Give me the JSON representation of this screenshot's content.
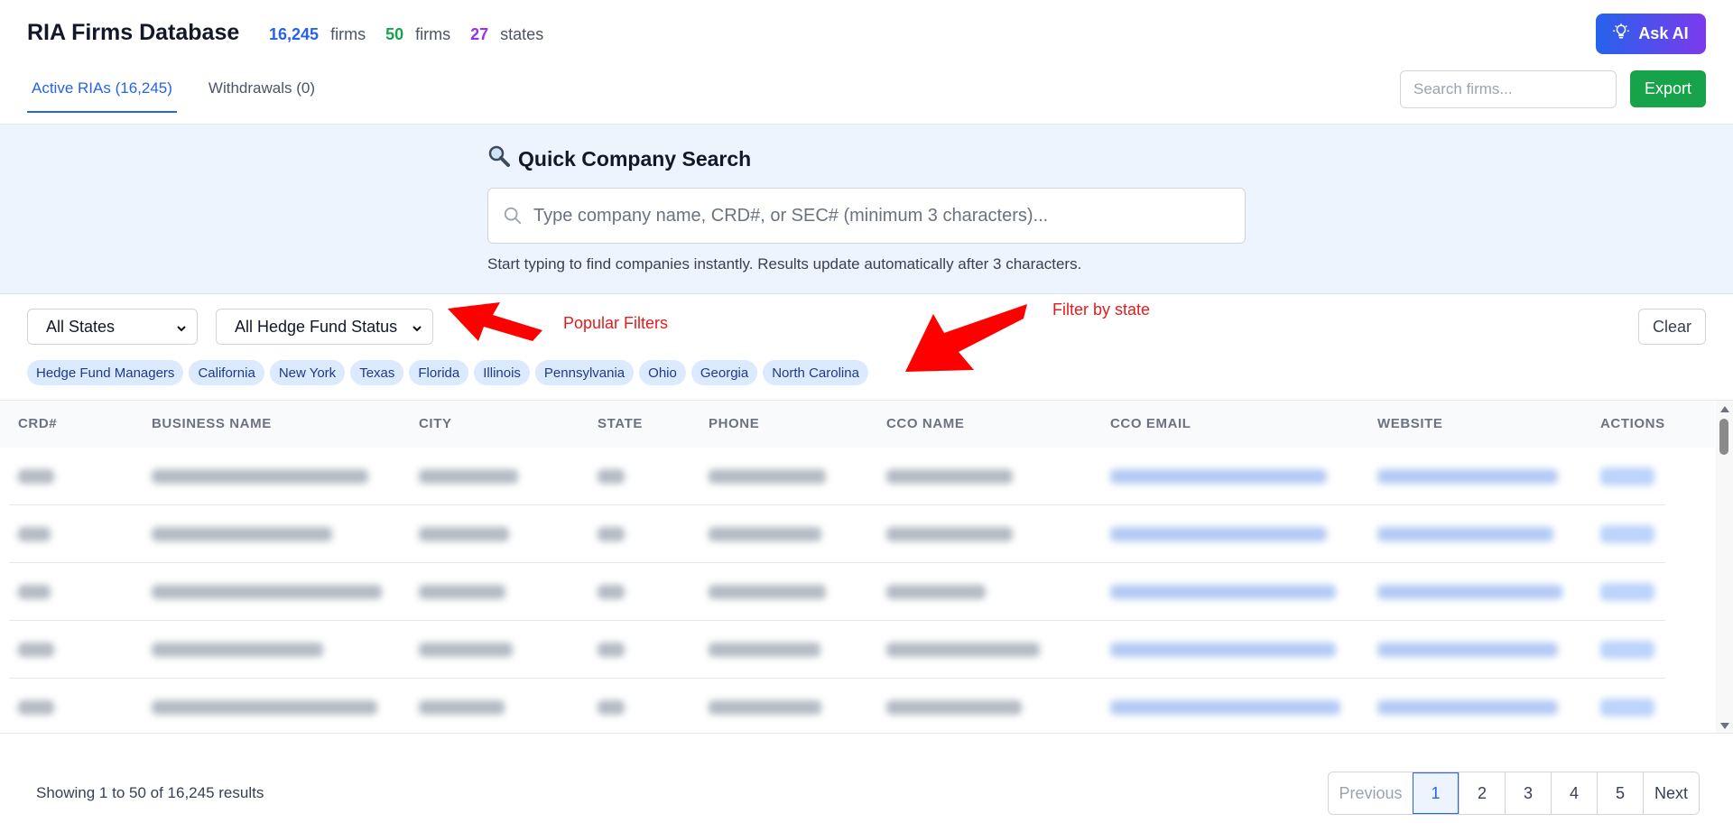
{
  "header": {
    "title": "RIA Firms Database",
    "stats": [
      {
        "value": "16,245",
        "unit": "firms",
        "color": "#2563eb"
      },
      {
        "value": "50",
        "unit": "firms",
        "color": "#16a34a"
      },
      {
        "value": "27",
        "unit": "states",
        "color": "#9333ea"
      }
    ],
    "ask_ai_label": "Ask AI",
    "tabs": [
      {
        "label": "Active RIAs (16,245)",
        "active": true
      },
      {
        "label": "Withdrawals (0)",
        "active": false
      }
    ],
    "search_placeholder": "Search firms...",
    "export_label": "Export"
  },
  "quick_search": {
    "title": "Quick Company Search",
    "placeholder": "Type company name, CRD#, or SEC# (minimum 3 characters)...",
    "hint": "Start typing to find companies instantly. Results update automatically after 3 characters."
  },
  "filters": {
    "state_select": "All States",
    "hedge_select": "All Hedge Fund Status",
    "clear_label": "Clear",
    "chips": [
      "Hedge Fund Managers",
      "California",
      "New York",
      "Texas",
      "Florida",
      "Illinois",
      "Pennsylvania",
      "Ohio",
      "Georgia",
      "North Carolina"
    ]
  },
  "annotations": {
    "popular_filters": "Popular Filters",
    "filter_by_state": "Filter by state"
  },
  "table": {
    "columns": [
      "CRD#",
      "BUSINESS NAME",
      "CITY",
      "STATE",
      "PHONE",
      "CCO NAME",
      "CCO EMAIL",
      "WEBSITE",
      "ACTIONS"
    ]
  },
  "footer": {
    "showing": "Showing 1 to 50 of 16,245 results",
    "previous": "Previous",
    "pages": [
      "1",
      "2",
      "3",
      "4",
      "5"
    ],
    "current_page": "1",
    "next": "Next"
  },
  "colors": {
    "accent": "#2563eb",
    "export": "#16a34a",
    "annotation": "#e11d1d"
  }
}
